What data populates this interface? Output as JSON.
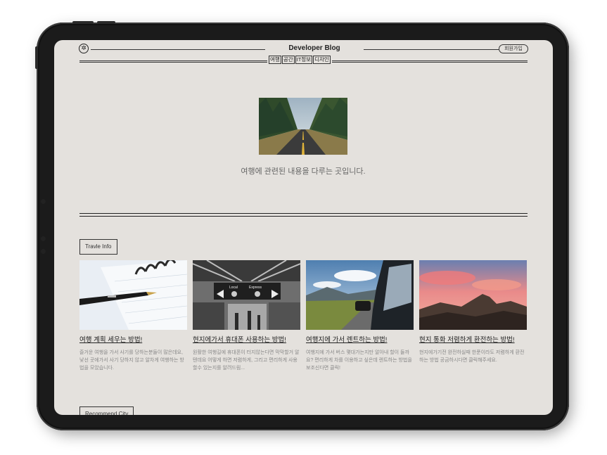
{
  "header": {
    "logo_glyph": "✲",
    "title": "Developer Blog",
    "signup_label": "회원가입",
    "nav": [
      "여행",
      "공간",
      "IT정보",
      "디자인"
    ]
  },
  "hero": {
    "image": "road-through-forest",
    "text": "여행에 관련된 내용을 다루는 곳입니다."
  },
  "section_travel": {
    "label": "Travle Info",
    "cards": [
      {
        "image": "notebook-and-pen",
        "title": "여행 계획 세우는 방법!",
        "desc": "즐거운 여행을 가서 사기를 당하는분들이 많은데요, 낯선 곳에가서 사기 당하지 않고 알차게 여행하는 방법을 모았습니다."
      },
      {
        "image": "subway-station-sign",
        "title": "현지에가서 휴대폰 사용하는 방법!",
        "desc": "원활한 여행길에 휴대폰이 터지않는다면 막막할거 알텐데요 어떻게 하면 저렴하게, 그리고 편리하게 사용할수 있는지를 알려드림..."
      },
      {
        "image": "car-mirror-road",
        "title": "여행지에 가서 렌트하는 방법!",
        "desc": "여행지에 가서 버스 몇대가는지만 알아내 할이 들까요? 편리하게 차를 이용하고 싶은데 렌트하는 방법을 보조신다면 클릭!"
      },
      {
        "image": "mountain-sunset",
        "title": "현지 통화 저렴하게 환전하는 방법!",
        "desc": "현지에가기전 완전하실때 한푼이라도 저렴하게 환전하는 방법 공금하시다면 클릭해주세요."
      }
    ]
  },
  "section_recommend": {
    "label": "Recommend City"
  }
}
